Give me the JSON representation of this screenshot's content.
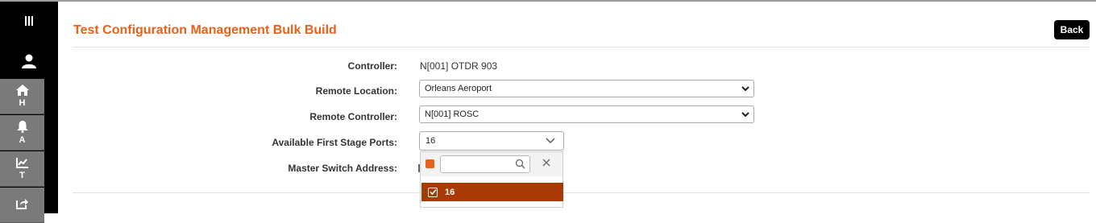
{
  "sidebar": {
    "items": [
      {
        "icon": "home-icon",
        "label": "H"
      },
      {
        "icon": "bell-icon",
        "label": "A"
      },
      {
        "icon": "chart-line-icon",
        "label": "T"
      },
      {
        "icon": "share-icon",
        "label": ""
      }
    ]
  },
  "page": {
    "title": "Test Configuration Management Bulk Build",
    "back_label": "Back"
  },
  "form": {
    "controller_label": "Controller:",
    "controller_value": "N[001] OTDR 903",
    "remote_location_label": "Remote Location:",
    "remote_location_value": "Orleans Aeroport",
    "remote_controller_label": "Remote Controller:",
    "remote_controller_value": "N[001] ROSC",
    "ports_label": "Available First Stage Ports:",
    "ports_value": "16",
    "master_label": "Master Switch Address:"
  },
  "dropdown": {
    "search_placeholder": "",
    "options": [
      {
        "label": "16",
        "checked": true
      }
    ]
  },
  "colors": {
    "accent": "#e8611a",
    "selected_option": "#a93a06",
    "sidebar_bg": "#000000",
    "sidebar_item": "#7a7a7a"
  }
}
